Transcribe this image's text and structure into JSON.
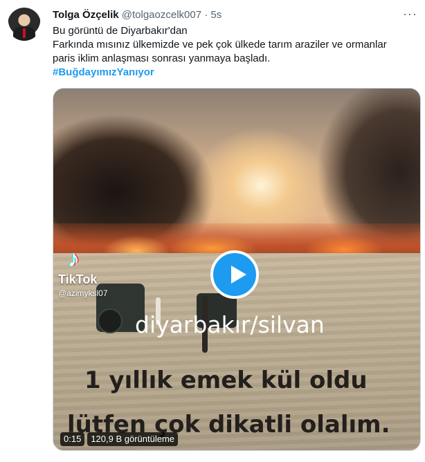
{
  "author": {
    "name": "Tolga Özçelik",
    "handle": "@tolgaozcelk007",
    "separator": "·",
    "time": "5s"
  },
  "tweet": {
    "line1": "Bu görüntü de Diyarbakır'dan",
    "line2": "Farkında mısınız ülkemizde ve pek çok ülkede tarım araziler ve ormanlar",
    "line3": "paris iklim anlaşması sonrası yanmaya başladı.",
    "hashtag": "#BuğdayımızYanıyor"
  },
  "more_icon": "more-horizontal-icon",
  "video": {
    "tiktok_brand": "TikTok",
    "tiktok_user": "@azimyksl07",
    "overlay_location": "diyarbakır/silvan",
    "overlay_line1": "1 yıllık emek kül oldu",
    "overlay_line2": "lütfen çok dikatli olalım.",
    "duration": "0:15",
    "views": "120,9 B görüntüleme",
    "play_icon": "play-icon",
    "accent": "#1d9bf0"
  }
}
